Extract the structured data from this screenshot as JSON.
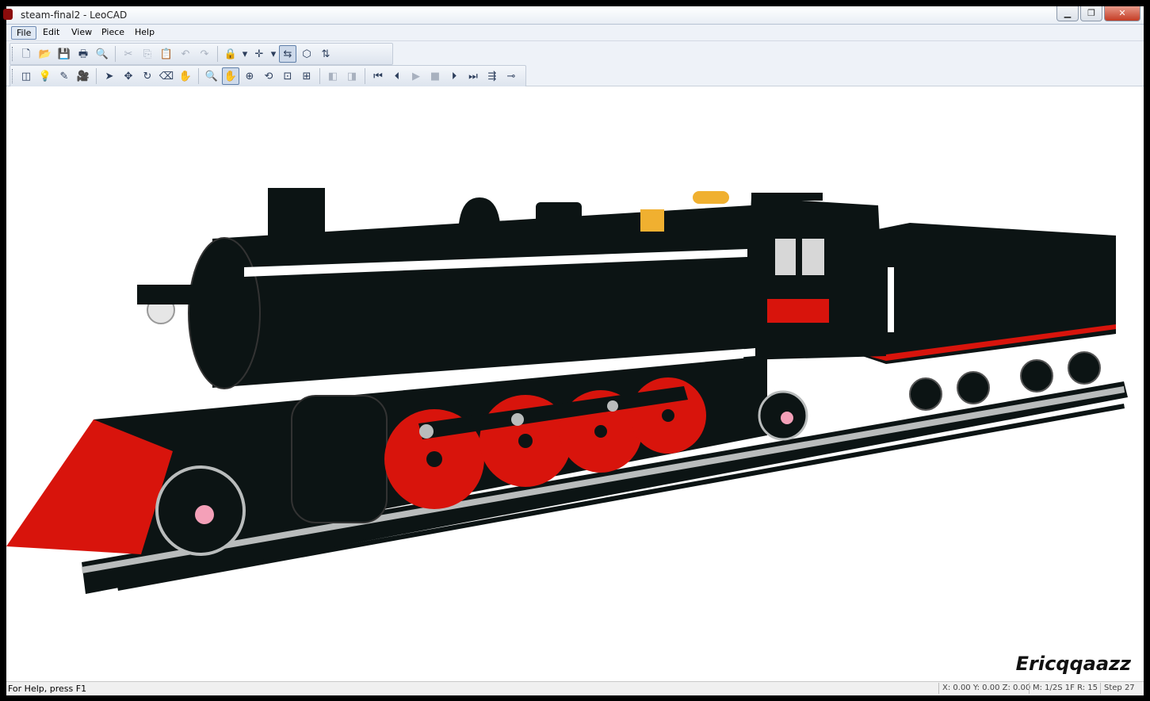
{
  "window": {
    "title": "steam-final2 - LeoCAD",
    "controls": {
      "minimize": "▁",
      "maximize": "❐",
      "close": "✕"
    }
  },
  "menu": {
    "file": "File",
    "edit": "Edit",
    "view": "View",
    "piece": "Piece",
    "help": "Help"
  },
  "toolbar_standard": {
    "new": "🗋",
    "open": "📂",
    "save": "💾",
    "print": "🖶",
    "preview": "🔍",
    "cut": "✂",
    "copy": "⎘",
    "paste": "📋",
    "undo": "↶",
    "redo": "↷",
    "snap": "🔒",
    "snap_menu": "▾",
    "lock": "✛",
    "lock_menu": "▾",
    "move_mode": "⇆",
    "angle": "⬡",
    "zoom_fit": "⇅"
  },
  "toolbar_tools": {
    "insert": "◫",
    "light": "💡",
    "spotlight": "✎",
    "camera": "🎥",
    "select": "➤",
    "move": "✥",
    "rotate": "↻",
    "erase": "⌫",
    "paint": "✋",
    "zoom": "🔍",
    "pan": "✋",
    "rotate_view": "⊕",
    "roll": "⟲",
    "zoom_region": "⊡",
    "zoom_extents": "⊞",
    "prev_piece": "◧",
    "next_piece": "◨",
    "first": "⏮",
    "prev": "⏴",
    "play": "▶",
    "stop": "■",
    "next": "⏵",
    "last": "⏭",
    "insert_step": "⇶",
    "key": "⊸"
  },
  "colors": {
    "accent": "#0a6cd6",
    "model_black": "#0c1414",
    "model_red": "#d8140c",
    "model_white": "#ffffff",
    "model_gray": "#b9bcbc",
    "model_yellow": "#f0b030",
    "model_pink": "#f4a0b8"
  },
  "viewport": {
    "watermark": "Ericqqaazz"
  },
  "status": {
    "help": "For Help, press F1",
    "coords": "X: 0.00 Y: 0.00 Z: 0.00",
    "snap": "M: 1/2S 1F R: 15",
    "step": "Step 27"
  }
}
